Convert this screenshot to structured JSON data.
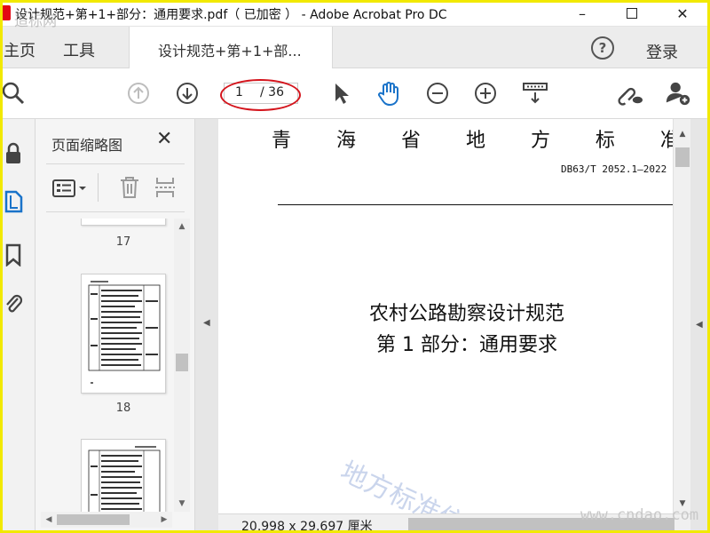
{
  "window": {
    "title": "设计规范+第+1+部分：通用要求.pdf（ 已加密 ） - Adobe Acrobat Pro DC",
    "min_label": "–",
    "close_label": "✕"
  },
  "tabs": {
    "home": "主页",
    "tools": "工具",
    "document": "设计规范+第+1+部...",
    "help": "?",
    "login": "登录"
  },
  "toolbar": {
    "current_page": "1",
    "total_pages": "/ 36",
    "icons": [
      "search-icon",
      "page-up-icon",
      "page-down-icon",
      "select-arrow-icon",
      "hand-icon",
      "zoom-out-icon",
      "zoom-in-icon",
      "page-layout-icon",
      "link-cloud-icon",
      "add-user-icon"
    ]
  },
  "thumbnail_panel": {
    "title": "页面缩略图",
    "close": "✕",
    "thumbnails": [
      {
        "label": "17"
      },
      {
        "label": "18"
      }
    ]
  },
  "document": {
    "province_heading": [
      "青",
      "海",
      "省",
      "地",
      "方",
      "标",
      "准"
    ],
    "standard_code": "DB63/T 2052.1—2022",
    "title": "农村公路勘察设计规范",
    "subtitle": "第 1 部分：通用要求",
    "watermark": "地方标准信"
  },
  "status": {
    "page_size": "20.998 x 29.697 厘米"
  },
  "watermarks": {
    "site": "www.cndao.com",
    "logo": "造标网"
  },
  "colors": {
    "frame": "#f2e900",
    "annotation": "#d4141c",
    "accent_blue": "#1a73c9"
  }
}
